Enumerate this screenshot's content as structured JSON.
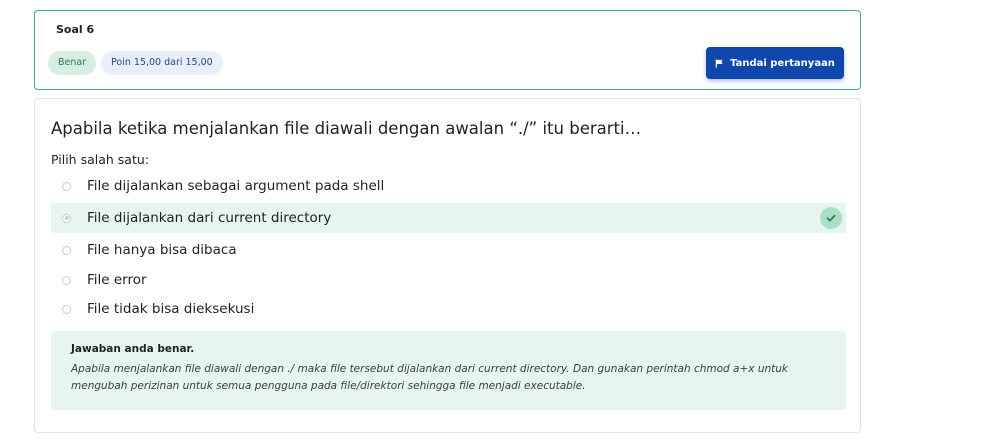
{
  "header": {
    "title": "Soal 6",
    "status_badge": "Benar",
    "points_badge": "Poin 15,00 dari 15,00",
    "flag_button": "Tandai pertanyaan",
    "border_color": "#3db07e"
  },
  "question": {
    "text": "Apabila ketika menjalankan file diawali dengan awalan “./” itu berarti…",
    "prompt": "Pilih salah satu:",
    "options": [
      {
        "label": "File dijalankan sebagai argument pada shell",
        "selected": false
      },
      {
        "label": "File dijalankan dari current directory",
        "selected": true
      },
      {
        "label": "File hanya bisa dibaca",
        "selected": false
      },
      {
        "label": "File error",
        "selected": false
      },
      {
        "label": "File tidak bisa dieksekusi",
        "selected": false
      }
    ]
  },
  "feedback": {
    "title": "Jawaban anda benar.",
    "text": "Apabila menjalankan file diawali dengan ./ maka file tersebut dijalankan dari current directory. Dan gunakan perintah chmod a+x untuk mengubah perizinan untuk semua pengguna pada file/direktori sehingga file menjadi executable.",
    "background": "#e6f5ee"
  },
  "icons": {
    "flag": "flag-icon",
    "correct": "check-icon"
  },
  "colors": {
    "accent": "#0f47ad",
    "correct": "#2c7a52"
  }
}
